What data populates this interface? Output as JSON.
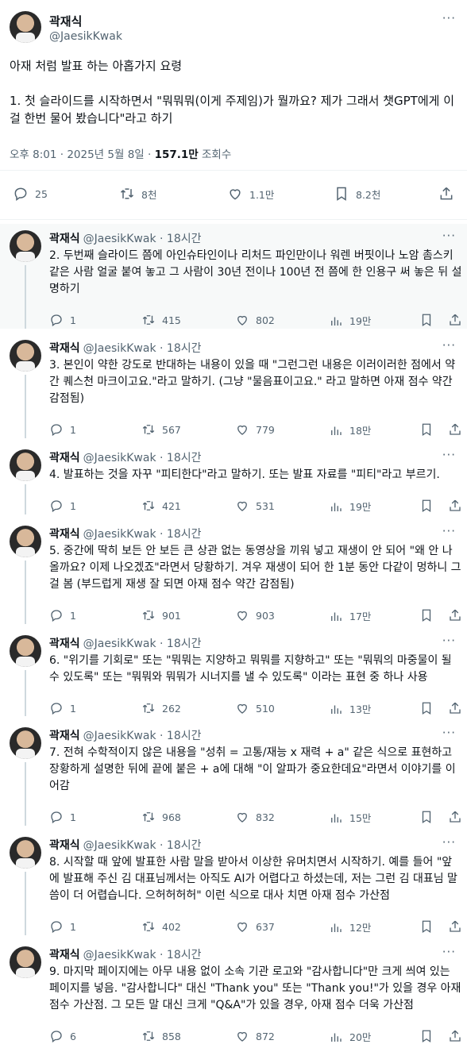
{
  "main": {
    "name": "곽재식",
    "handle": "@JaesikKwak",
    "text": "아재 처럼 발표 하는 아홉가지 요령\n\n1. 첫 슬라이드를 시작하면서 \"뭐뭐뭐(이게 주제임)가 뭘까요? 제가 그래서 챗GPT에게 이걸 한번 물어 봤습니다\"라고 하기",
    "time": "오후 8:01 · 2025년 5월 8일 · ",
    "views": "157.1만",
    "views_label": " 조회수",
    "replies": "25",
    "retweets": "8천",
    "likes": "1.1만",
    "bookmarks": "8.2천"
  },
  "replies": [
    {
      "name": "곽재식",
      "handle": "@JaesikKwak · 18시간",
      "text": "2. 두번째 슬라이드 쯤에 아인슈타인이나 리처드 파인만이나 워렌 버핏이나 노암 촘스키 같은 사람 얼굴 붙여 놓고 그 사람이 30년 전이나 100년 전 쯤에 한 인용구 써 놓은 뒤 설명하기",
      "replies": "1",
      "retweets": "415",
      "likes": "802",
      "views": "19만"
    },
    {
      "name": "곽재식",
      "handle": "@JaesikKwak · 18시간",
      "text": "3. 본인이 약한 강도로 반대하는 내용이 있을 때 \"그런그런 내용은 이러이러한 점에서 약간 퀘스천 마크이고요.\"라고 말하기. (그냥 \"물음표이고요.\" 라고 말하면 아재 점수 약간 감점됨)",
      "replies": "1",
      "retweets": "567",
      "likes": "779",
      "views": "18만"
    },
    {
      "name": "곽재식",
      "handle": "@JaesikKwak · 18시간",
      "text": "4. 발표하는 것을 자꾸 \"피티한다\"라고 말하기. 또는 발표 자료를 \"피티\"라고 부르기.",
      "replies": "1",
      "retweets": "421",
      "likes": "531",
      "views": "19만"
    },
    {
      "name": "곽재식",
      "handle": "@JaesikKwak · 18시간",
      "text": "5. 중간에 딱히 보든 안 보든 큰 상관 없는 동영상을 끼워 넣고 재생이 안 되어 \"왜 안 나올까요? 이제 나오겠죠\"라면서 당황하기. 겨우 재생이 되어 한 1분 동안 다같이 멍하니 그걸 봄 (부드럽게 재생 잘 되면 아재 점수 약간 감점됨)",
      "replies": "1",
      "retweets": "901",
      "likes": "903",
      "views": "17만"
    },
    {
      "name": "곽재식",
      "handle": "@JaesikKwak · 18시간",
      "text": "6. \"위기를 기회로\" 또는 \"뭐뭐는 지양하고 뭐뭐를 지향하고\" 또는 \"뭐뭐의 마중물이 될 수 있도록\" 또는 \"뭐뭐와 뭐뭐가 시너지를 낼 수 있도록\" 이라는 표현 중 하나 사용",
      "replies": "1",
      "retweets": "262",
      "likes": "510",
      "views": "13만"
    },
    {
      "name": "곽재식",
      "handle": "@JaesikKwak · 18시간",
      "text": "7. 전혀 수학적이지 않은 내용을 \"성취 = 고통/재능 x 재력 + a\" 같은 식으로 표현하고 장황하게 설명한 뒤에 끝에 붙은 + a에 대해 \"이 알파가 중요한데요\"라면서 이야기를 이어감",
      "replies": "1",
      "retweets": "968",
      "likes": "832",
      "views": "15만"
    },
    {
      "name": "곽재식",
      "handle": "@JaesikKwak · 18시간",
      "text": "8. 시작할 때 앞에 발표한 사람 말을 받아서 이상한 유머치면서 시작하기. 예를 들어 \"앞에 발표해 주신 김 대표님께서는 아직도 AI가 어렵다고 하셨는데, 저는 그런 김 대표님 말씀이 더 어렵습니다. 으허허허허\" 이런 식으로 대사 치면 아재 점수 가산점",
      "replies": "1",
      "retweets": "402",
      "likes": "637",
      "views": "12만"
    },
    {
      "name": "곽재식",
      "handle": "@JaesikKwak · 18시간",
      "text": "9. 마지막 페이지에는 아무 내용 없이 소속 기관 로고와 \"감사합니다\"만 크게 씌여 있는 페이지를 넣음. \"감사합니다\" 대신 \"Thank you\" 또는 \"Thank you!\"가 있을 경우 아재 점수 가산점. 그 모든 말 대신 크게 \"Q&A\"가 있을 경우, 아재 점수 더욱 가산점",
      "replies": "6",
      "retweets": "858",
      "likes": "872",
      "views": "20만"
    }
  ]
}
